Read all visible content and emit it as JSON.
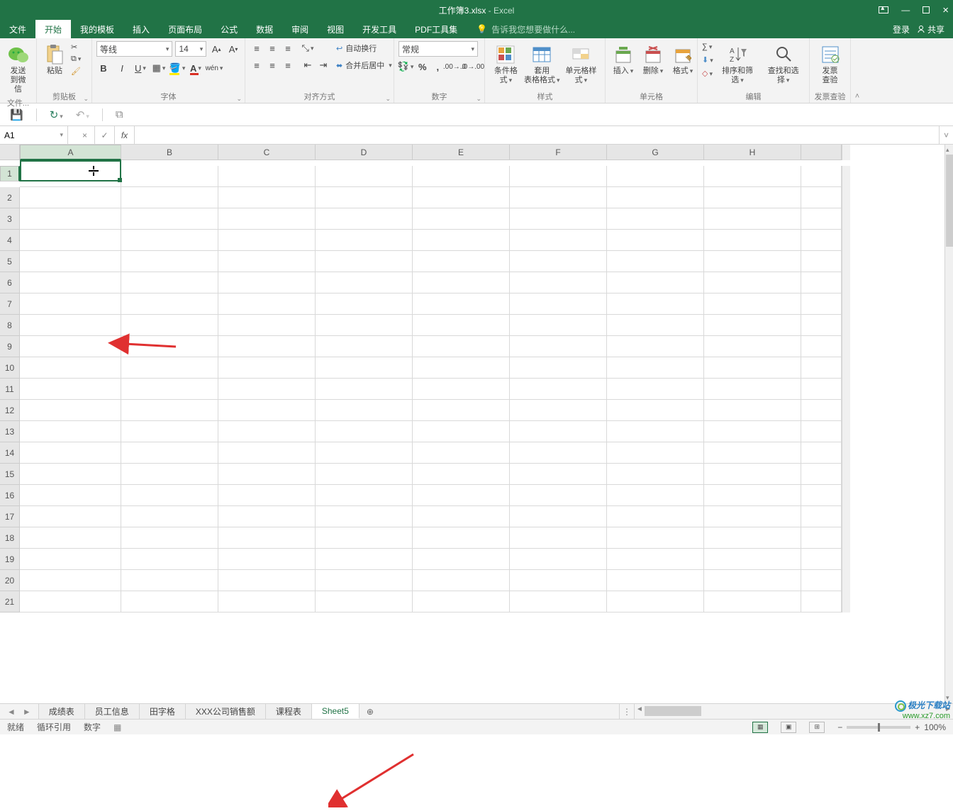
{
  "title": {
    "doc": "工作簿3.xlsx",
    "app": " - Excel"
  },
  "tabs": {
    "file": "文件",
    "home": "开始",
    "mytpl": "我的模板",
    "insert": "插入",
    "layout": "页面布局",
    "formulas": "公式",
    "data": "数据",
    "review": "审阅",
    "view": "视图",
    "dev": "开发工具",
    "pdf": "PDF工具集"
  },
  "tellme": "告诉我您想要做什么...",
  "login": "登录",
  "share": "共享",
  "ribbon": {
    "sendwechat": {
      "l1": "发送",
      "l2": "到微信",
      "group": "文件..."
    },
    "clipboard": {
      "paste": "粘贴",
      "group": "剪贴板"
    },
    "font": {
      "name": "等线",
      "size": "14",
      "group": "字体",
      "wen": "wén"
    },
    "align": {
      "wrap": "自动换行",
      "merge": "合并后居中",
      "group": "对齐方式"
    },
    "number": {
      "format": "常规",
      "group": "数字"
    },
    "styles": {
      "cond": "条件格式",
      "table": "套用\n表格格式",
      "cell": "单元格样式",
      "group": "样式"
    },
    "cells": {
      "insert": "插入",
      "delete": "删除",
      "format": "格式",
      "group": "单元格"
    },
    "editing": {
      "sort": "排序和筛选",
      "find": "查找和选择",
      "group": "编辑"
    },
    "invoice": {
      "l1": "发票",
      "l2": "查验",
      "group": "发票查验"
    }
  },
  "namebox": "A1",
  "columns": [
    "A",
    "B",
    "C",
    "D",
    "E",
    "F",
    "G",
    "H"
  ],
  "rows": [
    "1",
    "2",
    "3",
    "4",
    "5",
    "6",
    "7",
    "8",
    "9",
    "10",
    "11",
    "12",
    "13",
    "14",
    "15",
    "16",
    "17",
    "18",
    "19",
    "20",
    "21"
  ],
  "sheets": {
    "s1": "成绩表",
    "s2": "员工信息",
    "s3": "田字格",
    "s4": "XXX公司销售额",
    "s5": "课程表",
    "s6": "Sheet5"
  },
  "status": {
    "ready": "就绪",
    "circ": "循环引用",
    "num": "数字",
    "zoom": "100%"
  },
  "watermark": {
    "l1": "极光下载站",
    "l2": "www.xz7.com"
  }
}
